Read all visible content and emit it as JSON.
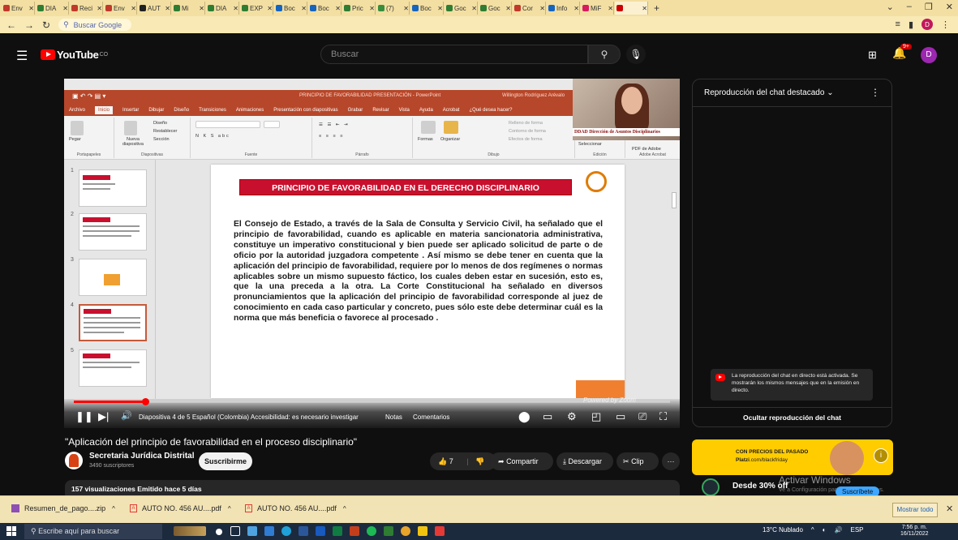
{
  "browser": {
    "tabs": [
      {
        "title": "Env",
        "color": "#c0392b"
      },
      {
        "title": "DIA",
        "color": "#2e7d32"
      },
      {
        "title": "Reci",
        "color": "#c0392b"
      },
      {
        "title": "Env",
        "color": "#c0392b"
      },
      {
        "title": "AUT",
        "color": "#212121"
      },
      {
        "title": "Mi",
        "color": "#2e7d32"
      },
      {
        "title": "DIA",
        "color": "#2e7d32"
      },
      {
        "title": "EXP",
        "color": "#2e7d32"
      },
      {
        "title": "Boc",
        "color": "#1565c0"
      },
      {
        "title": "Boc",
        "color": "#1565c0"
      },
      {
        "title": "Pric",
        "color": "#2e7d32"
      },
      {
        "title": "(7)",
        "color": "#388e3c"
      },
      {
        "title": "Boc",
        "color": "#1565c0"
      },
      {
        "title": "Goc",
        "color": "#2e7d32"
      },
      {
        "title": "Goc",
        "color": "#2e7d32"
      },
      {
        "title": "Cor",
        "color": "#c0392b"
      },
      {
        "title": "Info",
        "color": "#1565c0"
      },
      {
        "title": "MiF",
        "color": "#d81b60"
      },
      {
        "title": "",
        "color": "#cc0000"
      }
    ],
    "new_tab": "+",
    "address": "Buscar Google",
    "profile_initial": "D"
  },
  "youtube": {
    "logo": "YouTube",
    "country": "CO",
    "search_placeholder": "Buscar",
    "notif_count": "9+",
    "avatar_initial": "D"
  },
  "ppt": {
    "window_title": "PRINCIPIO DE FAVORABILIDAD PRESENTACIÓN - PowerPoint",
    "user": "Willington Rodríguez Arévalo",
    "menu": [
      "Archivo",
      "Inicio",
      "Insertar",
      "Dibujar",
      "Diseño",
      "Transiciones",
      "Animaciones",
      "Presentación con diapositivas",
      "Grabar",
      "Revisar",
      "Vista",
      "Ayuda",
      "Acrobat",
      "¿Qué desea hacer?"
    ],
    "ribbon": {
      "portapapeles": "Portapapeles",
      "pegar": "Pegar",
      "nueva": "Nueva diapositiva",
      "diseno": "Diseño",
      "restablecer": "Restablecer",
      "seccion": "Sección",
      "diapositivas": "Diapositivas",
      "fuente": "Fuente",
      "parrafo": "Párrafo",
      "formas": "Formas",
      "organizar": "Organizar",
      "estilos": "Estilos rápidos",
      "relleno": "Relleno de forma",
      "contorno": "Contorno de forma",
      "efectos": "Efectos de forma",
      "dibujo": "Dibujo",
      "seleccionar": "Seleccionar",
      "edicion": "Edición",
      "pdf": "PDF de Adobe",
      "acrobat": "Adobe Acrobat"
    },
    "thumb_numbers": [
      "1",
      "2",
      "3",
      "4",
      "5"
    ],
    "slide_title": "PRINCIPIO DE FAVORABILIDAD EN EL DERECHO DISCIPLINARIO",
    "slide_body": "El Consejo de Estado, a través de la Sala de Consulta y Servicio Civil, ha señalado que el principio de favorabilidad, cuando es aplicable en materia sancionatoria administrativa, constituye un imperativo constitucional y bien puede ser aplicado solicitud de parte o de oficio por la autoridad juzgadora competente . Así mismo se debe tener en cuenta que la aplicación del principio de favorabilidad, requiere por lo menos de dos regímenes o normas aplicables sobre un mismo supuesto fáctico, los cuales deben estar en sucesión, esto es, que la una preceda a la otra. La Corte Constitucional ha señalado en diversos pronunciamientos que la aplicación del principio de favorabilidad corresponde al juez de conocimiento en cada caso particular y concreto, pues sólo este debe determinar cuál es la norma que más beneficia o favorece al procesado .",
    "webcam_label": "DDAD Dirección de Asuntos Disciplinarios",
    "status_text": "Diapositiva 4 de 5   Español (Colombia)   Accesibilidad: es necesario investigar",
    "status_notes": "Notas",
    "status_comments": "Comentarios"
  },
  "player": {
    "progress": 0.12,
    "powered": "Powered by Zoom"
  },
  "chat": {
    "title": "Reproducción del chat destacado",
    "note": "La reproducción del chat en directo está activada. Se mostrarán los mismos mensajes que en la emisión en directo.",
    "hide": "Ocultar reproducción del chat"
  },
  "video": {
    "title": "\"Aplicación del principio de favorabilidad en el proceso disciplinario\"",
    "channel": "Secretaria Jurídica Distrital",
    "subs": "3490 suscriptores",
    "subscribe": "Suscribirme",
    "likes": "7",
    "share": "Compartir",
    "download": "Descargar",
    "clip": "Clip",
    "more": "···",
    "views": "157 visualizaciones  Emitido hace 5 días"
  },
  "ads": {
    "ad1_line1": "CON PRECIOS DEL PASADO",
    "ad1_line2": "Platzi",
    "ad1_line2b": ".com/blackfriday",
    "ad2_text": "Desde 30% off",
    "ad2_sub": "Suscríbete",
    "watermark": "Activar Windows",
    "watermark2": "Ve a Configuración para activar Windows."
  },
  "downloads": {
    "items": [
      "Resumen_de_pago....zip",
      "AUTO NO. 456 AU....pdf",
      "AUTO NO. 456 AU....pdf"
    ],
    "show_all": "Mostrar todo"
  },
  "taskbar": {
    "search": "Escribe aquí para buscar",
    "weather": "13°C  Nublado",
    "lang": "ESP",
    "time": "7:56 p. m.",
    "date": "16/11/2022"
  }
}
